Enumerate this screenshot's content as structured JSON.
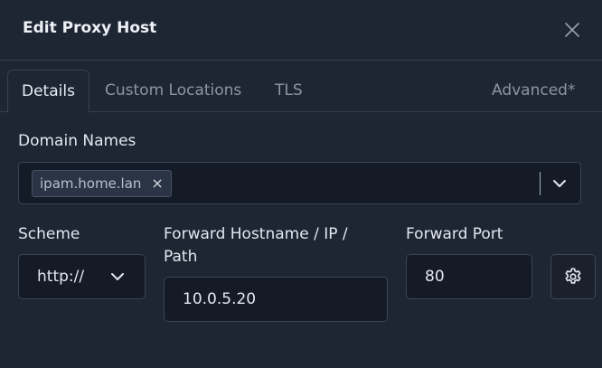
{
  "dialog": {
    "title": "Edit Proxy Host"
  },
  "tabs": [
    {
      "label": "Details",
      "active": true
    },
    {
      "label": "Custom Locations",
      "active": false
    },
    {
      "label": "TLS",
      "active": false
    },
    {
      "label": "Advanced*",
      "active": false
    }
  ],
  "domain_names": {
    "label": "Domain Names",
    "chips": [
      "ipam.home.lan"
    ],
    "remove_glyph": "×"
  },
  "scheme": {
    "label": "Scheme",
    "value": "http://"
  },
  "forward_host": {
    "label_line1": "Forward Hostname / IP /",
    "label_line2": "Path",
    "value": "10.0.5.20"
  },
  "forward_port": {
    "label": "Forward Port",
    "value": "80"
  },
  "icons": {
    "close": "close-icon",
    "chevron": "chevron-down-icon",
    "gear": "gear-icon"
  },
  "colors": {
    "background": "#1e2634",
    "input_bg": "#141b27",
    "border": "#394457",
    "text": "#e3e7ee",
    "muted_text": "#8b95a5"
  }
}
